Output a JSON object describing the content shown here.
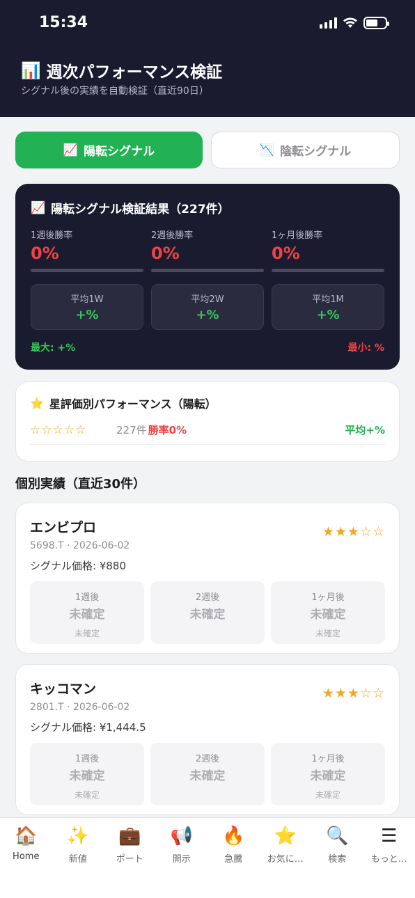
{
  "status": {
    "time": "15:34"
  },
  "header": {
    "icon": "📊",
    "title": "週次パフォーマンス検証",
    "subtitle": "シグナル後の実績を自動検証（直近90日）"
  },
  "tabs": [
    {
      "icon": "📈",
      "label": "陽転シグナル",
      "active": true
    },
    {
      "icon": "📉",
      "label": "陰転シグナル",
      "active": false
    }
  ],
  "summary": {
    "icon": "📈",
    "title": "陽転シグナル検証結果（227件）",
    "rates": [
      {
        "label": "1週後勝率",
        "value": "0%"
      },
      {
        "label": "2週後勝率",
        "value": "0%"
      },
      {
        "label": "1ヶ月後勝率",
        "value": "0%"
      }
    ],
    "averages": [
      {
        "label": "平均1W",
        "value": "+%"
      },
      {
        "label": "平均2W",
        "value": "+%"
      },
      {
        "label": "平均1M",
        "value": "+%"
      }
    ],
    "max": "最大: +%",
    "min": "最小: %"
  },
  "star_perf": {
    "icon": "⭐",
    "title": "星評価別パフォーマンス（陽転）",
    "stars": "☆☆☆☆☆",
    "count": "227件",
    "win": "勝率0%",
    "avg": "平均+%"
  },
  "section_title": "個別実績（直近30件）",
  "stocks": [
    {
      "name": "エンビプロ",
      "meta": "5698.T · 2026-06-02",
      "price": "シグナル価格: ¥880",
      "stars": "★★★☆☆",
      "periods": [
        {
          "label": "1週後",
          "value": "未確定",
          "sub": "未確定"
        },
        {
          "label": "2週後",
          "value": "未確定",
          "sub": ""
        },
        {
          "label": "1ヶ月後",
          "value": "未確定",
          "sub": "未確定"
        }
      ]
    },
    {
      "name": "キッコマン",
      "meta": "2801.T · 2026-06-02",
      "price": "シグナル価格: ¥1,444.5",
      "stars": "★★★☆☆",
      "periods": [
        {
          "label": "1週後",
          "value": "未確定",
          "sub": "未確定"
        },
        {
          "label": "2週後",
          "value": "未確定",
          "sub": ""
        },
        {
          "label": "1ヶ月後",
          "value": "未確定",
          "sub": "未確定"
        }
      ]
    }
  ],
  "tabbar": [
    {
      "icon": "🏠",
      "label": "Home"
    },
    {
      "icon": "✨",
      "label": "新値"
    },
    {
      "icon": "💼",
      "label": "ポート"
    },
    {
      "icon": "📢",
      "label": "開示"
    },
    {
      "icon": "🔥",
      "label": "急騰"
    },
    {
      "icon": "⭐",
      "label": "お気に…"
    },
    {
      "icon": "🔍",
      "label": "検索"
    },
    {
      "icon": "☰",
      "label": "もっと…"
    }
  ]
}
